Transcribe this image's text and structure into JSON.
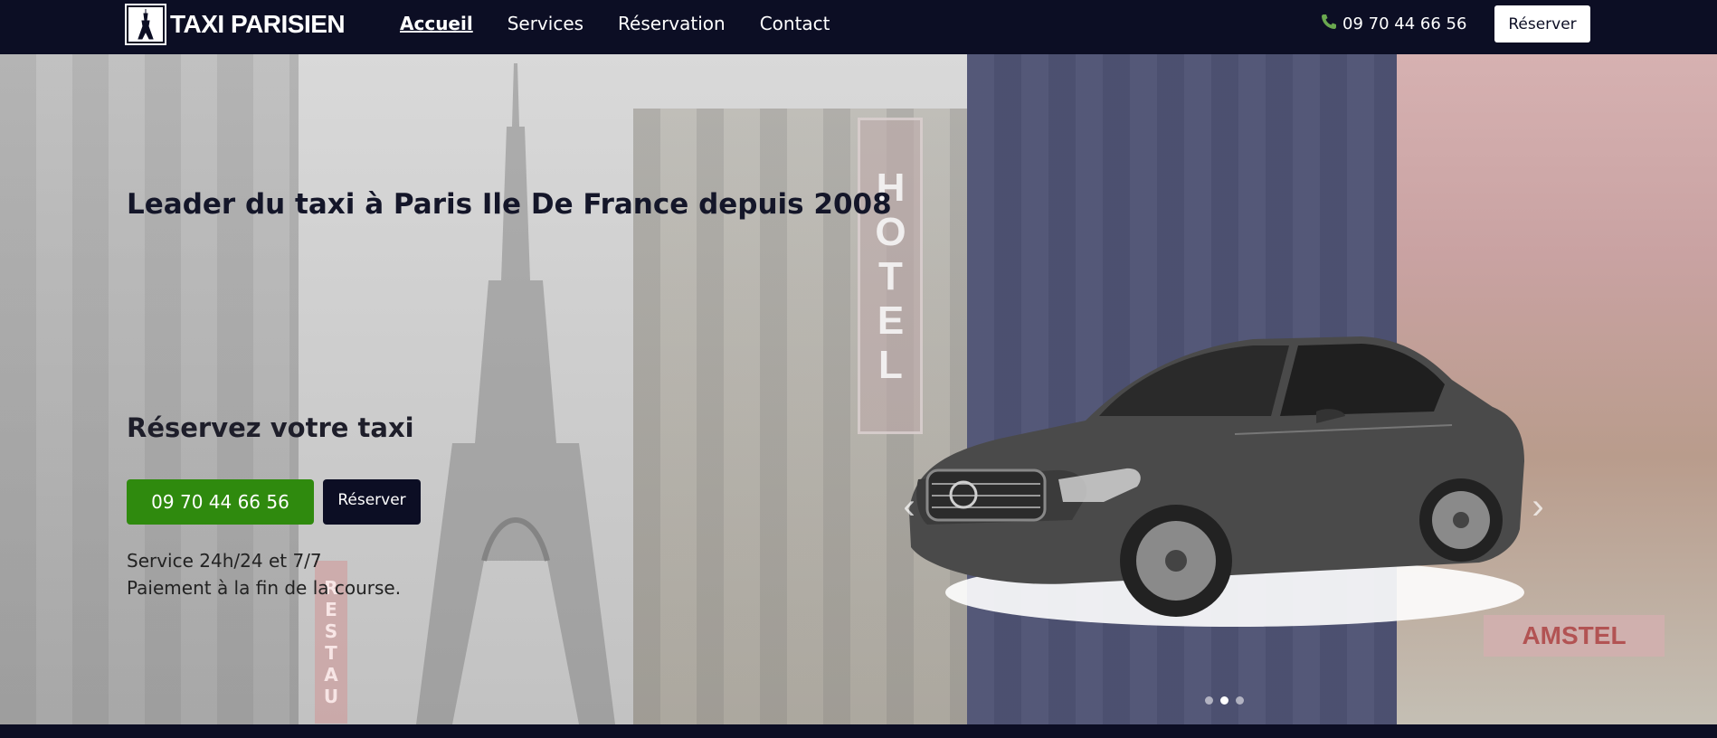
{
  "brand": {
    "name": "TAXI PARISIEN",
    "logo_icon": "eiffel-tower-icon"
  },
  "nav": {
    "links": [
      {
        "label": "Accueil",
        "active": true
      },
      {
        "label": "Services",
        "active": false
      },
      {
        "label": "Réservation",
        "active": false
      },
      {
        "label": "Contact",
        "active": false
      }
    ],
    "phone": "09 70 44 66 56",
    "phone_icon": "phone-icon",
    "cta_label": "Réserver"
  },
  "hero": {
    "title": "Leader du taxi à Paris Ile De France depuis 2008",
    "subtitle": "Réservez votre taxi",
    "phone_button": "09 70 44 66 56",
    "reserve_button": "Réserver",
    "info_line_1": "Service 24h/24 et 7/7",
    "info_line_2": "Paiement à la fin de la course."
  },
  "background_signs": {
    "hotel": "HOTEL",
    "restaurant": "RESTAU",
    "amstel": "AMSTEL"
  },
  "carousel": {
    "prev_icon": "chevron-left-icon",
    "next_icon": "chevron-right-icon",
    "dot_count": 3,
    "active_dot": 2
  },
  "colors": {
    "navy": "#0c0e24",
    "green": "#2f8a0e",
    "band": "#4f5374"
  }
}
